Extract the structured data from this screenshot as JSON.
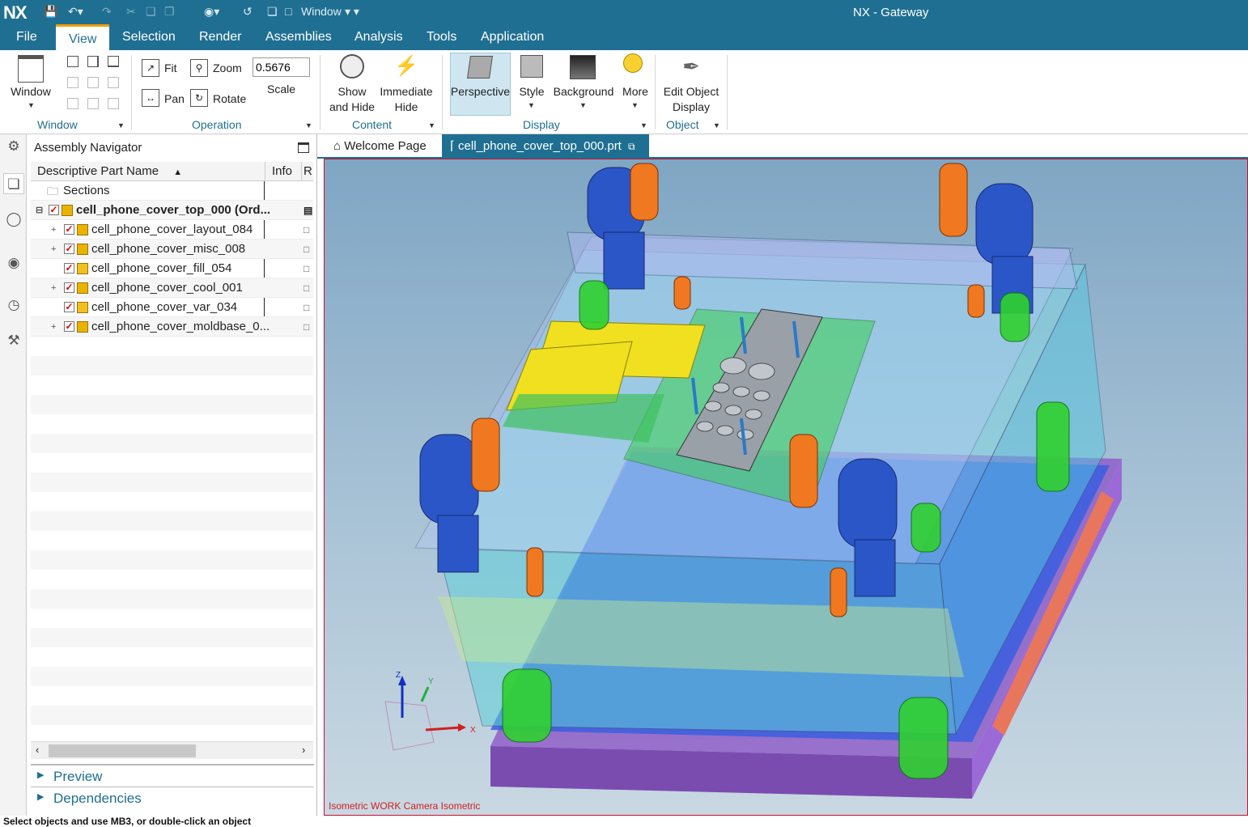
{
  "titlebar": {
    "logo": "NX",
    "window_label": "Window",
    "title": "NX - Gateway"
  },
  "menu": {
    "items": [
      "File",
      "View",
      "Selection",
      "Render",
      "Assemblies",
      "Analysis",
      "Tools",
      "Application"
    ],
    "active": "View"
  },
  "ribbon": {
    "window_btn": "Window",
    "fit": "Fit",
    "zoom": "Zoom",
    "pan": "Pan",
    "rotate": "Rotate",
    "scale_value": "0.5676",
    "scale_label": "Scale",
    "show_hide_1": "Show",
    "show_hide_2": "and Hide",
    "immediate_hide_1": "Immediate",
    "immediate_hide_2": "Hide",
    "perspective": "Perspective",
    "style": "Style",
    "background": "Background",
    "more": "More",
    "edit_object_1": "Edit Object",
    "edit_object_2": "Display",
    "groups": {
      "window": "Window",
      "operation": "Operation",
      "content": "Content",
      "display": "Display",
      "object": "Object"
    }
  },
  "navigator": {
    "title": "Assembly Navigator",
    "columns": [
      "Descriptive Part Name",
      "Info",
      "R"
    ],
    "rows": [
      {
        "name": "Sections",
        "level": 0
      },
      {
        "name": "cell_phone_cover_top_000 (Ord...",
        "level": 0
      },
      {
        "name": "cell_phone_cover_layout_084",
        "level": 1
      },
      {
        "name": "cell_phone_cover_misc_008",
        "level": 1
      },
      {
        "name": "cell_phone_cover_fill_054",
        "level": 1
      },
      {
        "name": "cell_phone_cover_cool_001",
        "level": 1
      },
      {
        "name": "cell_phone_cover_var_034",
        "level": 1
      },
      {
        "name": "cell_phone_cover_moldbase_0...",
        "level": 1
      }
    ],
    "preview": "Preview",
    "dependencies": "Dependencies"
  },
  "tabs": {
    "welcome": "Welcome Page",
    "active_file": "cell_phone_cover_top_000.prt"
  },
  "viewport": {
    "caption": "Isometric WORK Camera Isometric",
    "axis_x": "X",
    "axis_y": "Y",
    "axis_z": "Z"
  },
  "status": {
    "text": "Select objects and use MB3, or double-click an object"
  },
  "colors": {
    "accent": "#1f6f92",
    "highlight": "#f0a000"
  }
}
